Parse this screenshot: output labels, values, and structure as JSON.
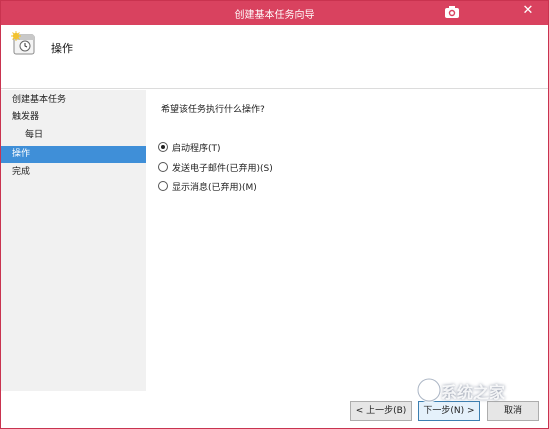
{
  "window": {
    "title": "创建基本任务向导",
    "close_glyph": "✕"
  },
  "header": {
    "title": "操作"
  },
  "steps": [
    {
      "label": "创建基本任务"
    },
    {
      "label": "触发器"
    },
    {
      "label": "每日"
    },
    {
      "label": "操作"
    },
    {
      "label": "完成"
    }
  ],
  "main": {
    "question": "希望该任务执行什么操作?",
    "options": [
      {
        "label": "启动程序(T)",
        "checked": true
      },
      {
        "label": "发送电子邮件(已弃用)(S)",
        "checked": false
      },
      {
        "label": "显示消息(已弃用)(M)",
        "checked": false
      }
    ]
  },
  "footer": {
    "back_label": "< 上一步(B)",
    "next_label": "下一步(N) >",
    "cancel_label": "取消"
  },
  "watermark": {
    "text": "系统之家"
  },
  "colors": {
    "titlebar": "#d9425f",
    "selection": "#3f8fd8"
  }
}
